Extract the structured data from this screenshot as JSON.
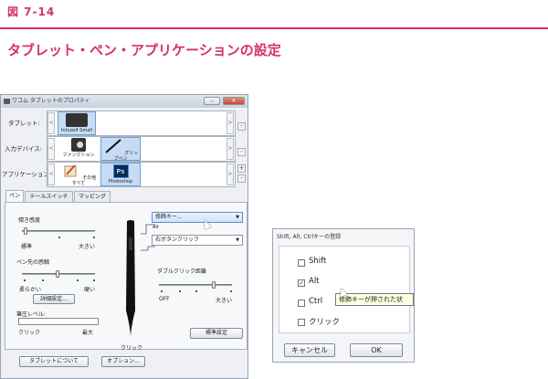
{
  "figure": {
    "label": "図 7-14",
    "heading": "タブレット・ペン・アプリケーションの設定"
  },
  "dialog": {
    "title": "ワコム タブレットのプロパティ",
    "rows": {
      "tablet": {
        "label": "タブレット:",
        "items": [
          "Intuos4 Small"
        ]
      },
      "device": {
        "label": "入力デバイス:",
        "items": [
          "ファンクション",
          "グリップペン"
        ]
      },
      "application": {
        "label": "アプリケーション:",
        "items": [
          "その他すべて",
          "Photoshop"
        ]
      }
    },
    "side_buttons": {
      "minus": "-",
      "plus": "+"
    },
    "tabs": [
      "ペン",
      "テールスイッチ",
      "マッピング"
    ],
    "tilt": {
      "title": "傾き感度",
      "min": "標準",
      "max": "大きい"
    },
    "tip_feel": {
      "title": "ペン先の感触",
      "min": "柔らかい",
      "max": "硬い",
      "detail_button": "詳細設定..."
    },
    "pressure": {
      "title": "筆圧レベル:",
      "left": "クリック",
      "right": "最大"
    },
    "pen_buttons": {
      "upper": "修飾キー...",
      "upper_sub": "Alt",
      "lower": "右ボタンクリック",
      "tip": "クリック"
    },
    "double_click": {
      "title": "ダブルクリック距離",
      "min": "OFF",
      "max": "大きい"
    },
    "default_button": "標準設定",
    "footer": {
      "about": "タブレットについて",
      "options": "オプション..."
    }
  },
  "modifier_dialog": {
    "title": "Shift, Alt, Ctrlキーの登録",
    "options": [
      {
        "label": "Shift",
        "checked": false
      },
      {
        "label": "Alt",
        "checked": true
      },
      {
        "label": "Ctrl",
        "checked": false
      },
      {
        "label": "クリック",
        "checked": false
      }
    ],
    "tooltip": "修飾キーが押された状",
    "cancel": "キャンセル",
    "ok": "OK"
  }
}
